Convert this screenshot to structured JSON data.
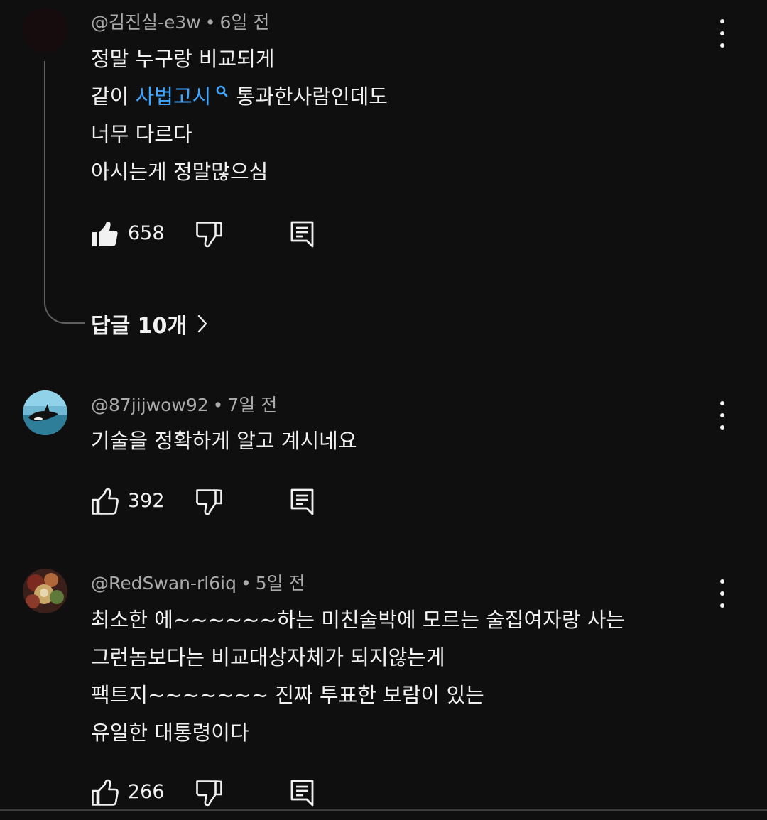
{
  "comments": [
    {
      "author": "@김진실-e3w",
      "time": "6일 전",
      "lines": [
        "정말 누구랑  비교되게",
        "",
        "너무 다르다",
        "아시는게 정말많으심"
      ],
      "line2_prefix": "같이 ",
      "line2_link": "사법고시",
      "line2_suffix": " 통과한사람인데도",
      "likes": "658",
      "liked": true,
      "replies_label": "답글 10개"
    },
    {
      "author": "@87jijwow92",
      "time": "7일 전",
      "lines": [
        "기술을  정확하게 알고 계시네요"
      ],
      "likes": "392",
      "liked": false
    },
    {
      "author": "@RedSwan-rl6iq",
      "time": "5일 전",
      "lines": [
        "최소한 에~~~~~~하는 미친술박에 모르는 술집여자랑 사는",
        "그런놈보다는 비교대상자체가 되지않는게",
        "팩트지~~~~~~~ 진짜 투표한 보람이 있는",
        "유일한 대통령이다"
      ],
      "likes": "266",
      "liked": false
    }
  ],
  "separator": "•",
  "icons": {
    "like": "thumbs-up-icon",
    "dislike": "thumbs-down-icon",
    "reply": "reply-icon",
    "menu": "more-vert-icon",
    "chevron": "chevron-right-icon",
    "search": "search-icon"
  },
  "colors": {
    "background": "#0f0f0f",
    "text": "#f1f1f1",
    "meta": "#aaaaaa",
    "link": "#3ea6ff"
  }
}
